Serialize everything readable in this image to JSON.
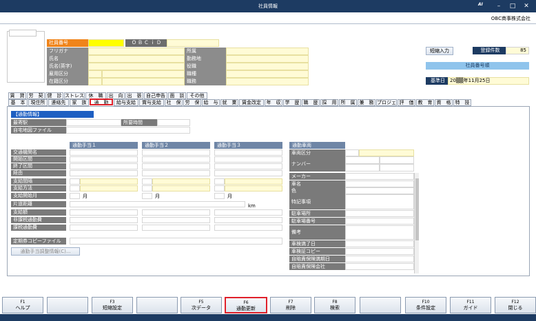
{
  "window": {
    "title": "社員情報",
    "min": "–",
    "max": "□",
    "close": "✕",
    "brand": "AI"
  },
  "company": "OBC商事株式会社",
  "emp": {
    "labels": {
      "no": "社員番号",
      "obcid": "ＯＢＣｉＤ",
      "kana": "フリガナ",
      "name": "氏名",
      "name_en": "氏名(英字)",
      "employ": "雇用区分",
      "status": "在籍区分",
      "dept": "所属",
      "location": "勤務地",
      "position": "役職",
      "job": "職種",
      "duty": "職務"
    }
  },
  "right": {
    "abbr_input": "短縮入力",
    "count_label": "登録件数",
    "count": "85",
    "order": "社員番号順",
    "base_date_label": "基準日",
    "base_date": "20▒▒年11月25日"
  },
  "tabs_row1": [
    "賃　貸",
    "労　契",
    "健　診",
    "ストレス",
    "休　職",
    "出　向",
    "出　張",
    "自己申告",
    "面　談",
    "その他"
  ],
  "tabs_row2": [
    "基　本",
    "現住所",
    "連絡先",
    "家　族",
    "通　勤",
    "給与支給",
    "賞与支給",
    "社　保",
    "労　保",
    "給　与",
    "就　業",
    "賃金改定",
    "年　収",
    "学　歴",
    "職　歴",
    "採　用",
    "所　属",
    "兼　務",
    "プロジェ",
    "評　価",
    "教　育",
    "資　格",
    "特　技"
  ],
  "section_title": "【通勤情報】",
  "commute": {
    "station_label": "最寄駅",
    "time_label": "所要時間",
    "map_label": "自宅地図ファイル"
  },
  "allowance_headers": [
    "通勤手当１",
    "通勤手当２",
    "通勤手当３"
  ],
  "vehicle_header": "通勤車両",
  "row_labels": [
    "交通機関名",
    "開始区間",
    "終了区間",
    "経由",
    "支給間隔",
    "支給方法",
    "支給開始月",
    "片道距離",
    "支給額",
    "非課税通勤費",
    "課税通勤費"
  ],
  "month_unit": "月",
  "km_unit": "km",
  "pass_label": "定期券コピーファイル",
  "adjust_button": "通勤手当調整情報(C)...",
  "vehicle_labels": [
    "車両区分",
    "ナンバー",
    "メーカー",
    "車名",
    "色",
    "特記事項",
    "駐車場所",
    "駐車場番号",
    "備考",
    "車検満了日",
    "車検証コピー",
    "自賠責保険満期日",
    "自賠責保険会社"
  ],
  "fkeys": [
    {
      "key": "F1",
      "label": "ヘルプ"
    },
    {
      "key": "",
      "label": ""
    },
    {
      "key": "F3",
      "label": "短縮設定"
    },
    {
      "key": "",
      "label": ""
    },
    {
      "key": "F5",
      "label": "次データ"
    },
    {
      "key": "F6",
      "label": "通勤更新"
    },
    {
      "key": "F7",
      "label": "削除"
    },
    {
      "key": "F8",
      "label": "検索"
    },
    {
      "key": "",
      "label": ""
    },
    {
      "key": "F10",
      "label": "条件設定"
    },
    {
      "key": "F11",
      "label": "ガイド"
    },
    {
      "key": "F12",
      "label": "閉じる"
    }
  ]
}
